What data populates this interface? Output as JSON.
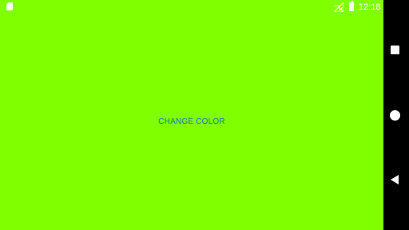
{
  "status_bar": {
    "time": "12:18",
    "icons": [
      "sd-card-icon",
      "no-signal-icon",
      "battery-icon"
    ]
  },
  "main": {
    "button_label": "CHANGE COLOR",
    "background_color": "#80ff00",
    "button_text_color": "#0a7fb8"
  },
  "nav_bar": {
    "icons": [
      "recents-icon",
      "home-icon",
      "back-icon"
    ]
  }
}
